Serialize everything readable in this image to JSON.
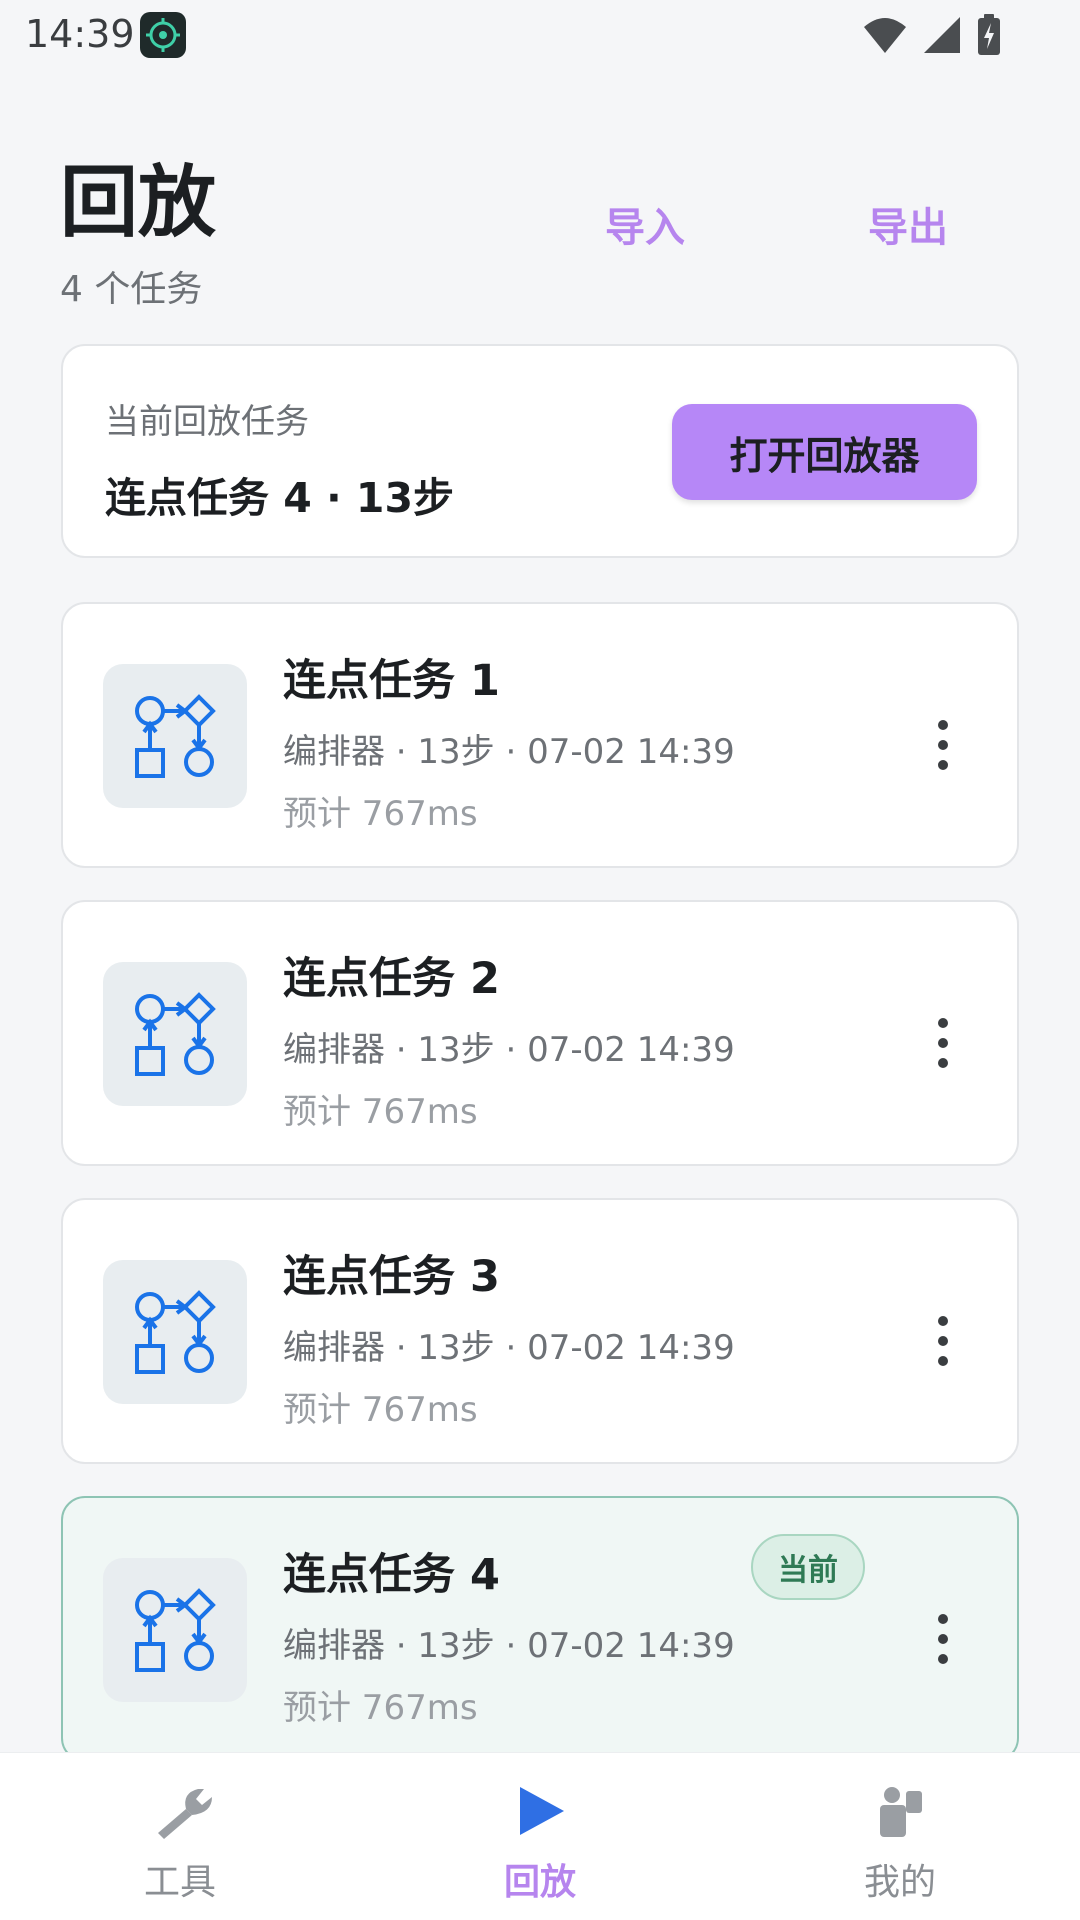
{
  "status_bar": {
    "time": "14:39"
  },
  "header": {
    "title": "回放",
    "subtitle": "4 个任务",
    "import_label": "导入",
    "export_label": "导出"
  },
  "current": {
    "label": "当前回放任务",
    "task": "连点任务 4 · 13步",
    "open_button": "打开回放器"
  },
  "tasks": [
    {
      "name": "连点任务 1",
      "meta": "编排器 · 13步 · 07-02 14:39",
      "estimate": "预计 767ms",
      "badge": ""
    },
    {
      "name": "连点任务 2",
      "meta": "编排器 · 13步 · 07-02 14:39",
      "estimate": "预计 767ms",
      "badge": ""
    },
    {
      "name": "连点任务 3",
      "meta": "编排器 · 13步 · 07-02 14:39",
      "estimate": "预计 767ms",
      "badge": ""
    },
    {
      "name": "连点任务 4",
      "meta": "编排器 · 13步 · 07-02 14:39",
      "estimate": "预计 767ms",
      "badge": "当前"
    }
  ],
  "nav": {
    "items": [
      {
        "label": "工具",
        "icon": "wrench-icon"
      },
      {
        "label": "回放",
        "icon": "play-icon"
      },
      {
        "label": "我的",
        "icon": "profile-icon"
      }
    ],
    "active_index": 1
  },
  "colors": {
    "accent": "#b685ee",
    "button": "#b687f7",
    "icon_blue": "#1a73e8",
    "badge_green": "#2f7a55"
  }
}
